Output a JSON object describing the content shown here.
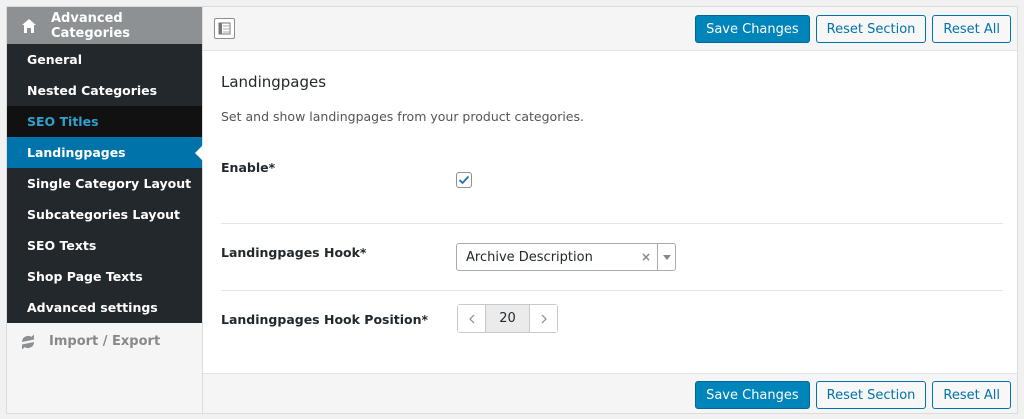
{
  "sidebar": {
    "header": "Advanced Categories",
    "items": [
      {
        "label": "General"
      },
      {
        "label": "Nested Categories"
      },
      {
        "label": "SEO Titles"
      },
      {
        "label": "Landingpages"
      },
      {
        "label": "Single Category Layout"
      },
      {
        "label": "Subcategories Layout"
      },
      {
        "label": "SEO Texts"
      },
      {
        "label": "Shop Page Texts"
      },
      {
        "label": "Advanced settings"
      }
    ],
    "import_export": "Import / Export"
  },
  "toolbar": {
    "save_label": "Save Changes",
    "reset_section_label": "Reset Section",
    "reset_all_label": "Reset All"
  },
  "section": {
    "title": "Landingpages",
    "description": "Set and show landingpages from your product categories."
  },
  "fields": {
    "enable": {
      "label": "Enable*",
      "checked": true
    },
    "hook": {
      "label": "Landingpages Hook*",
      "value": "Archive Description"
    },
    "position": {
      "label": "Landingpages Hook Position*",
      "value": "20"
    }
  },
  "colors": {
    "accent": "#0073aa",
    "primary_button": "#0085ba",
    "sidebar_bg": "#23282d",
    "sidebar_header": "#8d9193"
  }
}
